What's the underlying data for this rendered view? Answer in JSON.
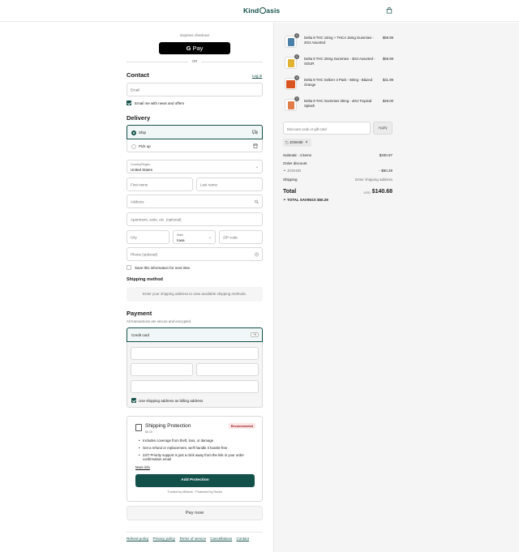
{
  "header": {
    "logo_text_a": "Kind",
    "logo_text_b": "asis"
  },
  "express": {
    "label": "Express checkout",
    "gpay_g": "G",
    "gpay_pay": " Pay",
    "or": "OR"
  },
  "contact": {
    "title": "Contact",
    "login": "Log in",
    "email_placeholder": "Email",
    "news_label": "Email me with news and offers"
  },
  "delivery": {
    "title": "Delivery",
    "ship": "Ship",
    "pickup": "Pick up",
    "country_label": "Country/Region",
    "country_value": "United States",
    "first_name": "First name",
    "last_name": "Last name",
    "address": "Address",
    "apartment": "Apartment, suite, etc. (optional)",
    "city": "City",
    "state_label": "State",
    "state_value": "Iowa",
    "zip": "ZIP code",
    "phone": "Phone (optional)",
    "save_label": "Save this information for next time"
  },
  "shipping_method": {
    "title": "Shipping method",
    "info": "Enter your shipping address to view available shipping methods."
  },
  "payment": {
    "title": "Payment",
    "subtitle": "All transactions are secure and encrypted.",
    "credit_card": "Credit card",
    "more_cards": "+3",
    "billing_label": "Use shipping address as billing address"
  },
  "protection": {
    "title": "Shipping Protection",
    "price": "$6.15",
    "badge": "Recommended",
    "bullets": [
      "Includes coverage from theft, loss, or damage",
      "Get a refund or replacement, we'll handle it hassle-free",
      "24/7 Priority support is just a click away from the link in your order confirmation email"
    ],
    "more_info": "More info",
    "add_button": "Add Protection",
    "trusted": "Trusted by Millions · Protected by Route"
  },
  "pay_now": "Pay now",
  "footer": {
    "links": [
      "Refund policy",
      "Privacy policy",
      "Terms of service",
      "Cancellations",
      "Contact"
    ]
  },
  "cart": {
    "items": [
      {
        "qty": "1",
        "name": "Delta 8 THC 15mg + THCA 15mg Gummies - 20ct Assorted",
        "price": "$59.99",
        "color": "#4a7fa8"
      },
      {
        "qty": "1",
        "name": "Delta 9 THC 20mg Gummies - 30ct Assorted - SOUR",
        "price": "$59.99",
        "color": "#e2b331"
      },
      {
        "qty": "4",
        "name": "Delta 9 THC Seltzer 4 Pack - 50mg - Blazed Orange",
        "price": "$31.99",
        "color": "#d9541e"
      },
      {
        "qty": "1",
        "name": "Delta 9 THC Gummies 30mg - 40ct Tropical Splash",
        "price": "$49.00",
        "color": "#e07c4a"
      }
    ],
    "discount_placeholder": "Discount code or gift card",
    "apply": "Apply",
    "code": "JOSH30",
    "subtotal_label": "Subtotal · 4 items",
    "subtotal_value": "$200.97",
    "order_discount_label": "Order discount",
    "discount_code": "JOSH30",
    "discount_value": "- $60.29",
    "shipping_label": "Shipping",
    "shipping_value": "Enter shipping address",
    "total_label": "Total",
    "currency": "USD",
    "total_value": "$140.68",
    "savings_label": "TOTAL SAVINGS",
    "savings_value": "$60.29"
  }
}
